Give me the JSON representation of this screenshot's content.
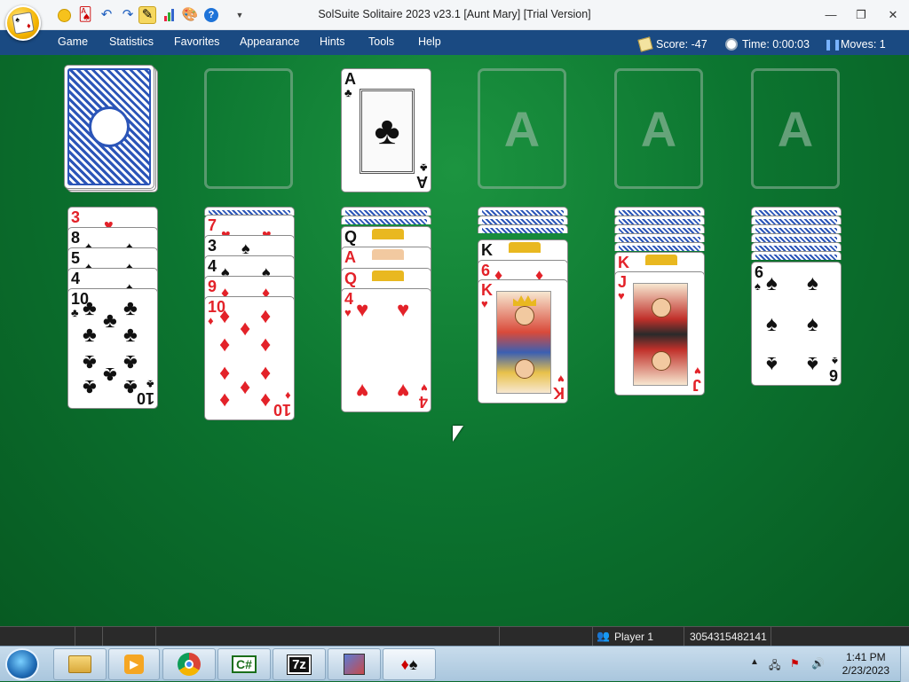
{
  "window": {
    "title": "SolSuite Solitaire 2023 v23.1  [Aunt Mary]  [Trial Version]",
    "minimize_label": "—",
    "restore_label": "❐",
    "close_label": "✕"
  },
  "quick_toolbar": {
    "icons": [
      "yellow-circle-icon",
      "card-icon",
      "undo-icon",
      "redo-icon",
      "pencil-icon",
      "chart-icon",
      "palette-icon",
      "help-icon",
      "dropdown-icon"
    ]
  },
  "menu": {
    "items": [
      "Game",
      "Statistics",
      "Favorites",
      "Appearance",
      "Hints",
      "Tools",
      "Help"
    ]
  },
  "stats": {
    "score": "Score: -47",
    "time": "Time: 0:00:03",
    "moves": "Moves: 1"
  },
  "foundation_label": "A",
  "stock": {
    "label": "stock"
  },
  "waste_card": {
    "rank": "A",
    "suit": "♣",
    "color": "black"
  },
  "tableau": [
    {
      "cards": [
        {
          "rank": "3",
          "suit": "♥",
          "color": "red"
        },
        {
          "rank": "8",
          "suit": "♠",
          "color": "black"
        },
        {
          "rank": "5",
          "suit": "♠",
          "color": "black"
        },
        {
          "rank": "4",
          "suit": "♠",
          "color": "black"
        },
        {
          "rank": "10",
          "suit": "♣",
          "color": "black"
        }
      ]
    },
    {
      "cards": [
        {
          "rank": "7",
          "suit": "♥",
          "color": "red"
        },
        {
          "rank": "3",
          "suit": "♠",
          "color": "black"
        },
        {
          "rank": "4",
          "suit": "♠",
          "color": "black"
        },
        {
          "rank": "9",
          "suit": "♦",
          "color": "red"
        },
        {
          "rank": "10",
          "suit": "♦",
          "color": "red"
        }
      ]
    },
    {
      "cards": [
        {
          "rank": "Q",
          "suit": "♣",
          "color": "black"
        },
        {
          "rank": "A",
          "suit": "♦",
          "color": "red"
        },
        {
          "rank": "Q",
          "suit": "♦",
          "color": "red"
        },
        {
          "rank": "4",
          "suit": "♥",
          "color": "red"
        }
      ]
    },
    {
      "cards": [
        {
          "rank": "K",
          "suit": "♣",
          "color": "black"
        },
        {
          "rank": "6",
          "suit": "♦",
          "color": "red"
        },
        {
          "rank": "K",
          "suit": "♥",
          "color": "red"
        }
      ]
    },
    {
      "cards": [
        {
          "rank": "K",
          "suit": "♦",
          "color": "red"
        },
        {
          "rank": "J",
          "suit": "♥",
          "color": "red"
        }
      ]
    },
    {
      "cards": [
        {
          "rank": "6",
          "suit": "♠",
          "color": "black"
        }
      ]
    }
  ],
  "statusbar": {
    "player": "Player 1",
    "game_number": "3054315482141"
  },
  "taskbar": {
    "apps": [
      "explorer-icon",
      "media-player-icon",
      "chrome-icon",
      "csharp-icon",
      "7zip-icon",
      "network-tool-icon",
      "solitaire-icon"
    ],
    "app_labels": {
      "csharp": "C#",
      "sevenzip": "7z"
    },
    "time": "1:41 PM",
    "date": "2/23/2023"
  }
}
